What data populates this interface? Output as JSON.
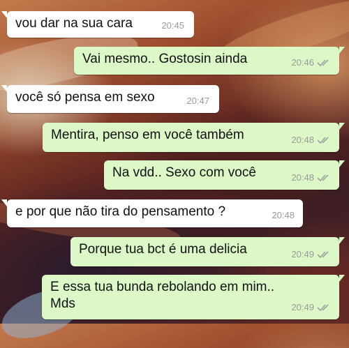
{
  "colors": {
    "incoming_bubble": "#ffffff",
    "outgoing_bubble": "#dcf8c6",
    "timestamp": "#999999",
    "read_ticks": "#a0a0a0"
  },
  "messages": [
    {
      "direction": "incoming",
      "text": "vou dar na sua cara",
      "time": "20:45"
    },
    {
      "direction": "outgoing",
      "text": "Vai mesmo.. Gostosin ainda",
      "time": "20:46",
      "status_icon": "double-check-icon"
    },
    {
      "direction": "incoming",
      "text": "você só pensa em sexo",
      "time": "20:47"
    },
    {
      "direction": "outgoing",
      "text": "Mentira, penso em você também",
      "time": "20:48",
      "status_icon": "double-check-icon"
    },
    {
      "direction": "outgoing",
      "text": "Na vdd.. Sexo com você",
      "time": "20:48",
      "status_icon": "double-check-icon"
    },
    {
      "direction": "incoming",
      "text": "e por que não tira do pensamento ?",
      "time": "20:48"
    },
    {
      "direction": "outgoing",
      "text": "Porque tua bct é uma delicia",
      "time": "20:49",
      "status_icon": "double-check-icon"
    },
    {
      "direction": "outgoing",
      "text_line1": "E essa tua bunda rebolando em mim..",
      "text_line2": "Mds",
      "time": "20:49",
      "status_icon": "double-check-icon"
    }
  ]
}
